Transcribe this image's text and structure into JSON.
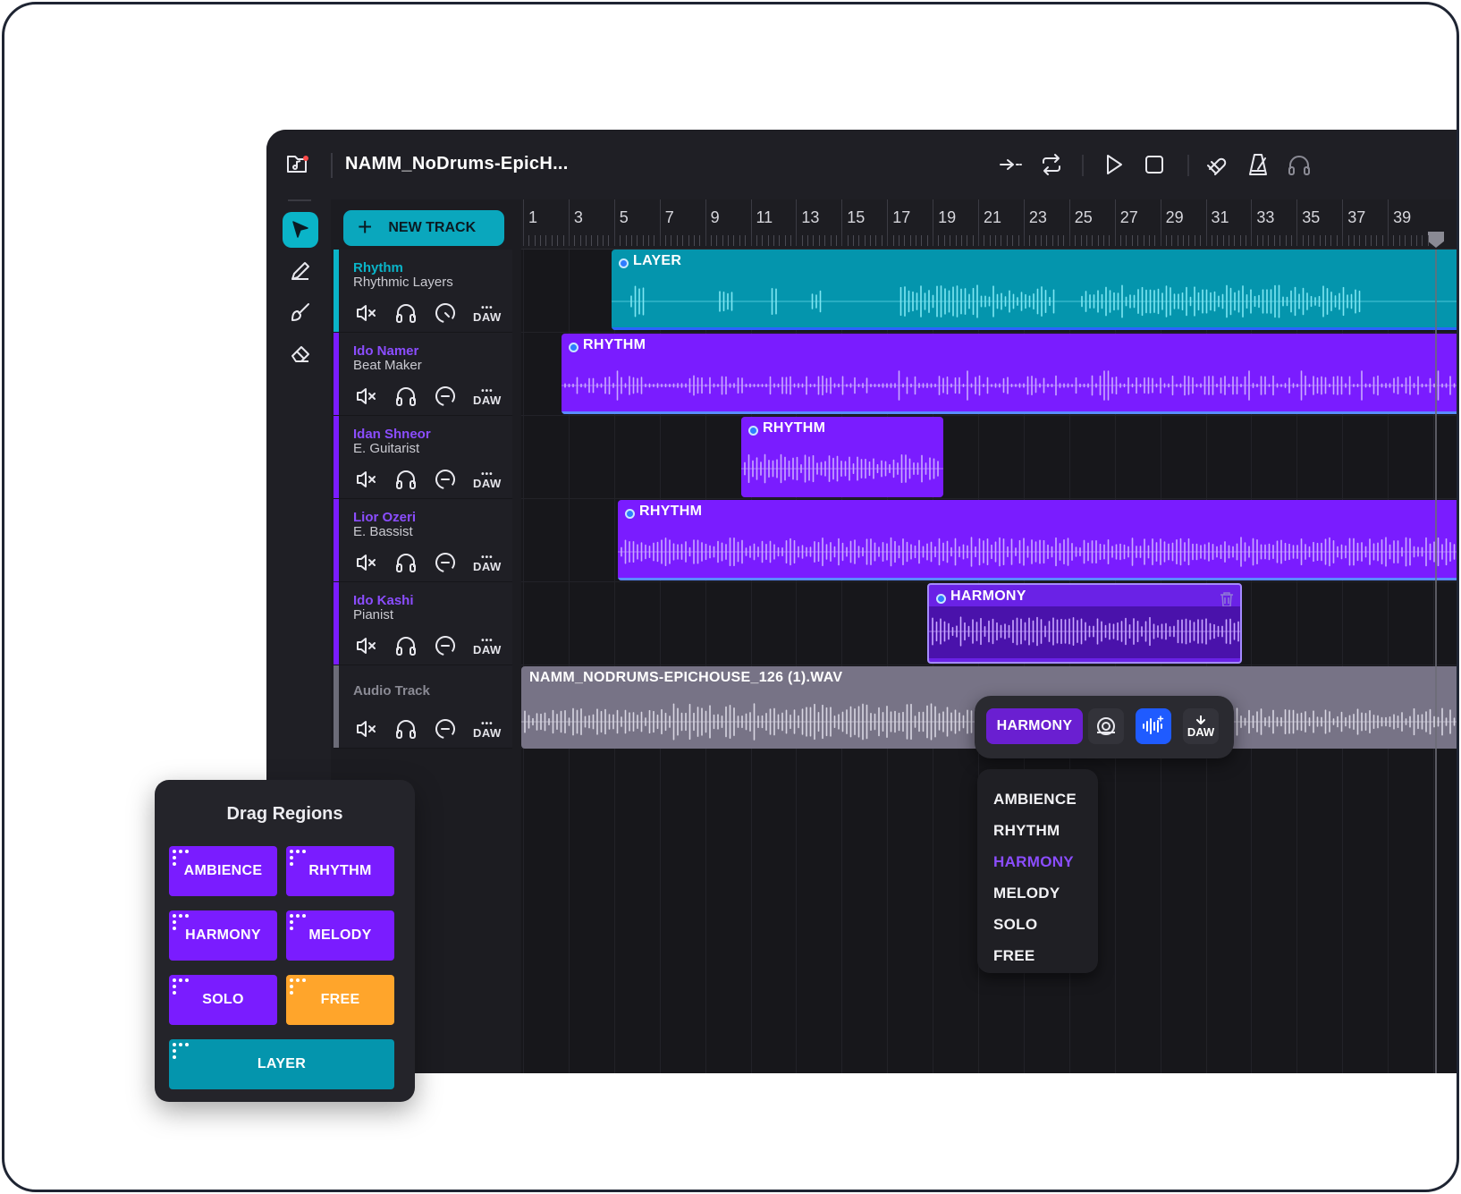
{
  "toolbar": {
    "song_title": "NAMM_NoDrums-EpicH...",
    "new_track_label": "NEW TRACK"
  },
  "ruler": {
    "labels": [
      "1",
      "3",
      "5",
      "7",
      "9",
      "11",
      "13",
      "15",
      "17",
      "19",
      "21",
      "23",
      "25",
      "27",
      "29",
      "31",
      "33",
      "35",
      "37",
      "39"
    ]
  },
  "tracks": [
    {
      "name": "Rhythm",
      "role": "Rhythmic Layers",
      "color": "#0ab4c8"
    },
    {
      "name": "Ido Namer",
      "role": "Beat Maker",
      "color": "#7a1cff"
    },
    {
      "name": "Idan Shneor",
      "role": "E. Guitarist",
      "color": "#7a1cff"
    },
    {
      "name": "Lior Ozeri",
      "role": "E. Bassist",
      "color": "#7a1cff"
    },
    {
      "name": "Ido Kashi",
      "role": "Pianist",
      "color": "#7a1cff"
    },
    {
      "name": "Audio Track",
      "role": "",
      "color": "#6c6c78"
    }
  ],
  "track_controls": {
    "daw_label": "DAW"
  },
  "regions": [
    {
      "label": "LAYER",
      "color": "#0495ad"
    },
    {
      "label": "RHYTHM",
      "color": "#7a1cff"
    },
    {
      "label": "RHYTHM",
      "color": "#7a1cff"
    },
    {
      "label": "RHYTHM",
      "color": "#7a1cff"
    },
    {
      "label": "HARMONY",
      "color": "#5a17c4"
    },
    {
      "label": "NAMM_NODRUMS-EPICHOUSE_126 (1).WAV",
      "color": "#777386"
    }
  ],
  "floating_bar": {
    "category_label": "HARMONY",
    "daw_label": "DAW"
  },
  "category_menu": {
    "items": [
      "AMBIENCE",
      "RHYTHM",
      "HARMONY",
      "MELODY",
      "SOLO",
      "FREE"
    ],
    "selected": "HARMONY"
  },
  "drag_regions": {
    "title": "Drag Regions",
    "chips": [
      {
        "label": "AMBIENCE",
        "color": "#7a1cff"
      },
      {
        "label": "RHYTHM",
        "color": "#7a1cff"
      },
      {
        "label": "HARMONY",
        "color": "#7a1cff"
      },
      {
        "label": "MELODY",
        "color": "#7a1cff"
      },
      {
        "label": "SOLO",
        "color": "#7a1cff"
      },
      {
        "label": "FREE",
        "color": "#ffa52b"
      },
      {
        "label": "LAYER",
        "color": "#0495ad"
      }
    ]
  },
  "colors": {
    "accent_teal": "#0ab4c8",
    "accent_purple": "#7a1cff",
    "accent_orange": "#ffa52b",
    "accent_blue": "#1f5bff"
  }
}
